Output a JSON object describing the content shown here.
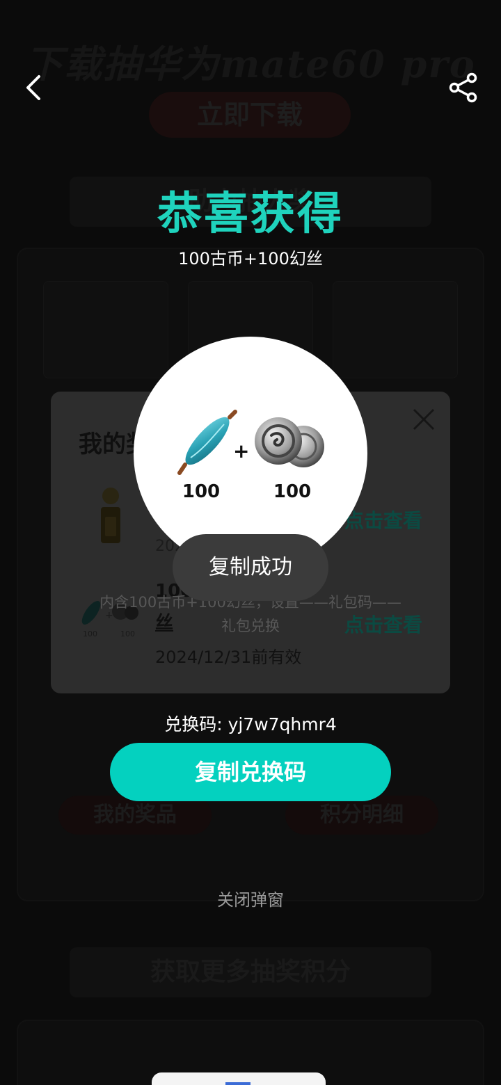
{
  "background": {
    "banner_title": "下载抽华为mate60 pro",
    "download_button": "立即下载",
    "section_prizes_title": "助力抽大奖",
    "section_more_title": "获取更多抽奖积分",
    "my_prizes_button": "我的奖品",
    "points_detail_button": "积分明细"
  },
  "header": {
    "title": "恭喜获得",
    "subtitle": "100古币+100幻丝"
  },
  "prizes_panel": {
    "title": "我的奖品",
    "item1": {
      "date": "2024/12/31前有效",
      "action": "点击查看"
    },
    "item2": {
      "name": "100古币+100幻丝",
      "name_visible": "丝",
      "name_head": "100",
      "date": "2024/12/31前有效",
      "action": "点击查看",
      "thumb_qty_a": "100",
      "thumb_qty_b": "100"
    },
    "description_line1": "内含100古币+100幻丝，设置——礼包码——",
    "description_line2": "礼包兑换"
  },
  "reward": {
    "qty_a": "100",
    "qty_b": "100",
    "plus": "+"
  },
  "toast": {
    "text": "复制成功"
  },
  "redeem": {
    "label": "兑换码: ",
    "code": "yj7w7qhmr4",
    "copy_button": "复制兑换码",
    "close_link": "关闭弹窗"
  },
  "colors": {
    "accent_teal": "#04d1bf",
    "title_teal": "#1fd3bd"
  },
  "icons": {
    "back": "chevron-left-icon",
    "share": "share-icon",
    "close": "close-icon"
  }
}
